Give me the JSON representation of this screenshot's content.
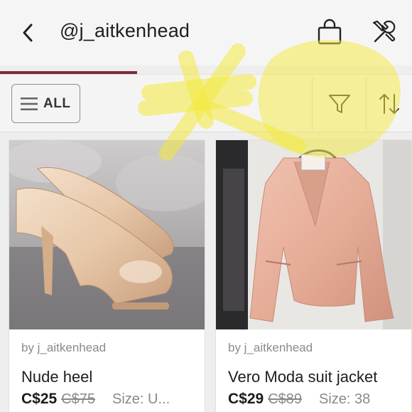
{
  "header": {
    "title": "@j_aitkenhead",
    "back_icon": "chevron-left-icon",
    "bag_icon": "shopping-bag-icon",
    "tools_icon": "tools-icon"
  },
  "filterbar": {
    "all_label": "ALL",
    "filter_icon": "filter-icon",
    "sort_icon": "sort-icon"
  },
  "listings": [
    {
      "seller": "by j_aitkenhead",
      "name": "Nude heel",
      "price": "C$25",
      "original_price": "C$75",
      "size": "Size: U..."
    },
    {
      "seller": "by j_aitkenhead",
      "name": "Vero Moda suit jacket",
      "price": "C$29",
      "original_price": "C$89",
      "size": "Size: 38"
    }
  ],
  "colors": {
    "accent": "#7b2d3a",
    "highlight": "#f6ef4a"
  }
}
